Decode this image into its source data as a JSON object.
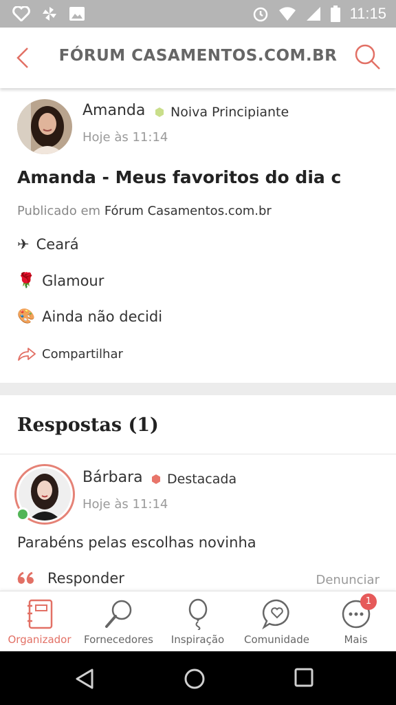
{
  "status_bar": {
    "time": "11:15"
  },
  "header": {
    "title": "FÓRUM CASAMENTOS.COM.BR"
  },
  "post": {
    "author": "Amanda",
    "badge": "Noiva Principiante",
    "badge_color": "#c9de8a",
    "date": "Hoje às 11:14",
    "title": "Amanda - Meus favoritos do dia c",
    "published_prefix": "Publicado em",
    "forum": "Fórum Casamentos.com.br",
    "preferences": [
      {
        "icon": "✈",
        "label": "Ceará"
      },
      {
        "icon": "🌹",
        "label": "Glamour"
      },
      {
        "icon": "🎨",
        "label": "Ainda não decidi"
      }
    ],
    "share_label": "Compartilhar"
  },
  "answers": {
    "heading": "Respostas (1)",
    "items": [
      {
        "author": "Bárbara",
        "badge": "Destacada",
        "badge_color": "#e8756a",
        "date": "Hoje às 11:14",
        "text": "Parabéns pelas escolhas novinha",
        "reply_label": "Responder",
        "report_label": "Denunciar"
      }
    ]
  },
  "tabbar": {
    "accent": "#e27065",
    "items": [
      {
        "label": "Organizador",
        "icon": "planner-book-icon",
        "active": true
      },
      {
        "label": "Fornecedores",
        "icon": "magnifier-icon",
        "active": false
      },
      {
        "label": "Inspiração",
        "icon": "balloon-icon",
        "active": false
      },
      {
        "label": "Comunidade",
        "icon": "chat-heart-icon",
        "active": false
      },
      {
        "label": "Mais",
        "icon": "more-dots-icon",
        "active": false,
        "badge": "1"
      }
    ]
  }
}
